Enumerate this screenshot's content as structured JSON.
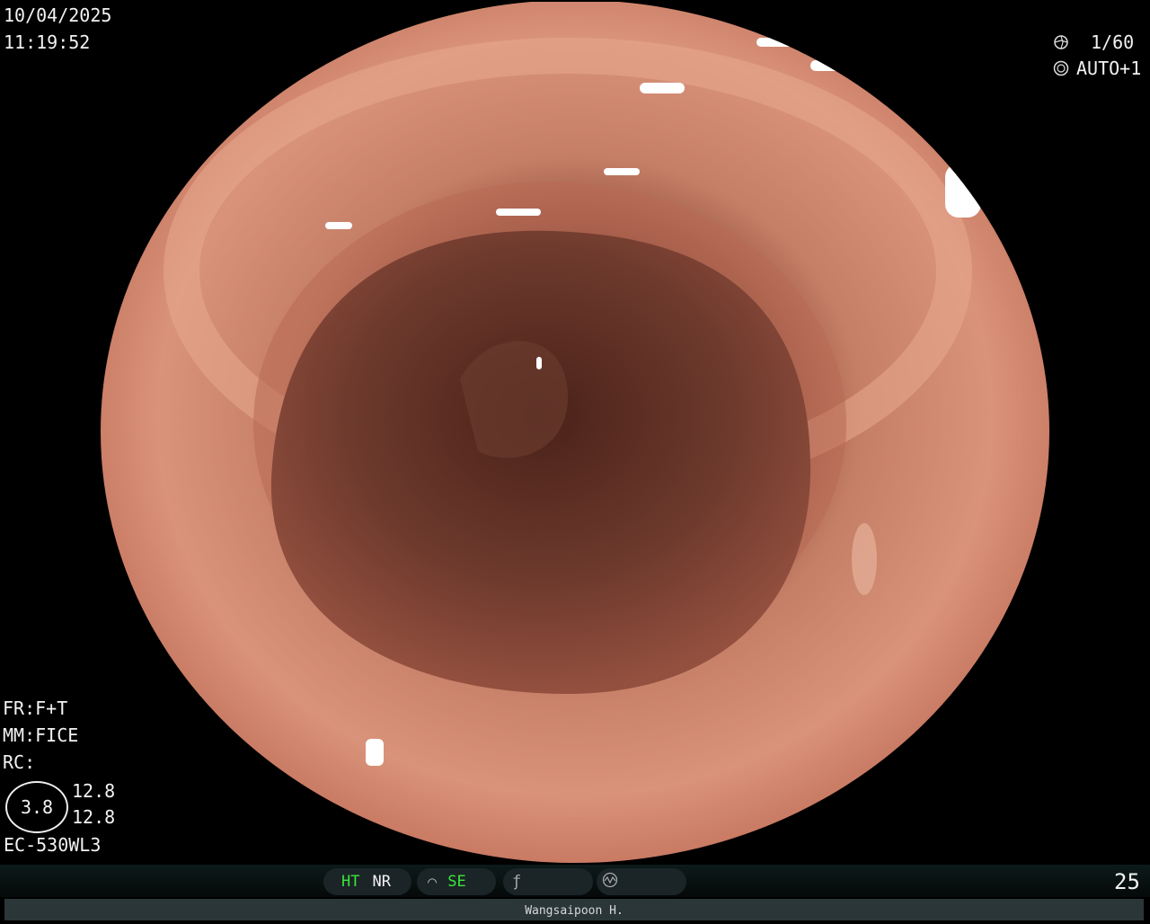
{
  "overlay": {
    "date": "10/04/2025",
    "time": "11:19:52",
    "shutter": "1/60",
    "iris": "AUTO+1",
    "fr": "FR:F+T",
    "mm": "MM:FICE",
    "rc": "RC:",
    "zoom_value": "3.8",
    "val_a": "12.8",
    "val_b": "12.8",
    "scope_model": "EC-530WL3"
  },
  "status_bar": {
    "ht": "HT",
    "nr": "NR",
    "se": "SE",
    "counter": "25"
  },
  "footer": {
    "operator": "Wangsaipoon H."
  },
  "colors": {
    "mucosa": "#c8785e",
    "lumen": "#5a2e24",
    "indicator_green": "#39e639"
  },
  "icons": [
    "aperture-icon",
    "iris-icon",
    "structure-icon",
    "color-enhance-icon",
    "waveform-icon"
  ]
}
